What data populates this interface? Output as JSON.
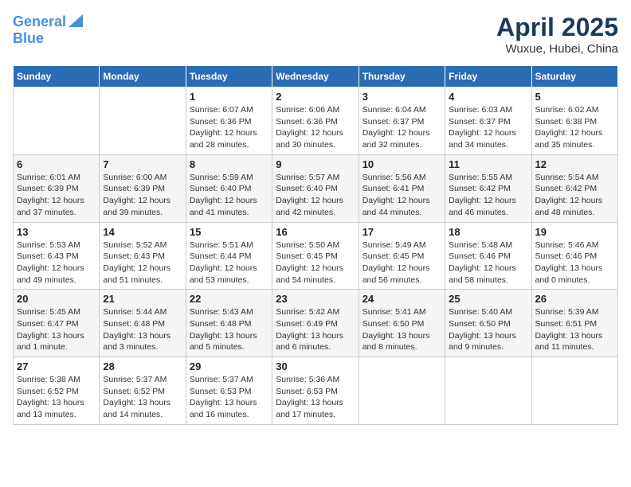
{
  "header": {
    "logo_line1": "General",
    "logo_line2": "Blue",
    "month_title": "April 2025",
    "location": "Wuxue, Hubei, China"
  },
  "weekdays": [
    "Sunday",
    "Monday",
    "Tuesday",
    "Wednesday",
    "Thursday",
    "Friday",
    "Saturday"
  ],
  "weeks": [
    [
      {
        "day": "",
        "info": ""
      },
      {
        "day": "",
        "info": ""
      },
      {
        "day": "1",
        "info": "Sunrise: 6:07 AM\nSunset: 6:36 PM\nDaylight: 12 hours and 28 minutes."
      },
      {
        "day": "2",
        "info": "Sunrise: 6:06 AM\nSunset: 6:36 PM\nDaylight: 12 hours and 30 minutes."
      },
      {
        "day": "3",
        "info": "Sunrise: 6:04 AM\nSunset: 6:37 PM\nDaylight: 12 hours and 32 minutes."
      },
      {
        "day": "4",
        "info": "Sunrise: 6:03 AM\nSunset: 6:37 PM\nDaylight: 12 hours and 34 minutes."
      },
      {
        "day": "5",
        "info": "Sunrise: 6:02 AM\nSunset: 6:38 PM\nDaylight: 12 hours and 35 minutes."
      }
    ],
    [
      {
        "day": "6",
        "info": "Sunrise: 6:01 AM\nSunset: 6:39 PM\nDaylight: 12 hours and 37 minutes."
      },
      {
        "day": "7",
        "info": "Sunrise: 6:00 AM\nSunset: 6:39 PM\nDaylight: 12 hours and 39 minutes."
      },
      {
        "day": "8",
        "info": "Sunrise: 5:59 AM\nSunset: 6:40 PM\nDaylight: 12 hours and 41 minutes."
      },
      {
        "day": "9",
        "info": "Sunrise: 5:57 AM\nSunset: 6:40 PM\nDaylight: 12 hours and 42 minutes."
      },
      {
        "day": "10",
        "info": "Sunrise: 5:56 AM\nSunset: 6:41 PM\nDaylight: 12 hours and 44 minutes."
      },
      {
        "day": "11",
        "info": "Sunrise: 5:55 AM\nSunset: 6:42 PM\nDaylight: 12 hours and 46 minutes."
      },
      {
        "day": "12",
        "info": "Sunrise: 5:54 AM\nSunset: 6:42 PM\nDaylight: 12 hours and 48 minutes."
      }
    ],
    [
      {
        "day": "13",
        "info": "Sunrise: 5:53 AM\nSunset: 6:43 PM\nDaylight: 12 hours and 49 minutes."
      },
      {
        "day": "14",
        "info": "Sunrise: 5:52 AM\nSunset: 6:43 PM\nDaylight: 12 hours and 51 minutes."
      },
      {
        "day": "15",
        "info": "Sunrise: 5:51 AM\nSunset: 6:44 PM\nDaylight: 12 hours and 53 minutes."
      },
      {
        "day": "16",
        "info": "Sunrise: 5:50 AM\nSunset: 6:45 PM\nDaylight: 12 hours and 54 minutes."
      },
      {
        "day": "17",
        "info": "Sunrise: 5:49 AM\nSunset: 6:45 PM\nDaylight: 12 hours and 56 minutes."
      },
      {
        "day": "18",
        "info": "Sunrise: 5:48 AM\nSunset: 6:46 PM\nDaylight: 12 hours and 58 minutes."
      },
      {
        "day": "19",
        "info": "Sunrise: 5:46 AM\nSunset: 6:46 PM\nDaylight: 13 hours and 0 minutes."
      }
    ],
    [
      {
        "day": "20",
        "info": "Sunrise: 5:45 AM\nSunset: 6:47 PM\nDaylight: 13 hours and 1 minute."
      },
      {
        "day": "21",
        "info": "Sunrise: 5:44 AM\nSunset: 6:48 PM\nDaylight: 13 hours and 3 minutes."
      },
      {
        "day": "22",
        "info": "Sunrise: 5:43 AM\nSunset: 6:48 PM\nDaylight: 13 hours and 5 minutes."
      },
      {
        "day": "23",
        "info": "Sunrise: 5:42 AM\nSunset: 6:49 PM\nDaylight: 13 hours and 6 minutes."
      },
      {
        "day": "24",
        "info": "Sunrise: 5:41 AM\nSunset: 6:50 PM\nDaylight: 13 hours and 8 minutes."
      },
      {
        "day": "25",
        "info": "Sunrise: 5:40 AM\nSunset: 6:50 PM\nDaylight: 13 hours and 9 minutes."
      },
      {
        "day": "26",
        "info": "Sunrise: 5:39 AM\nSunset: 6:51 PM\nDaylight: 13 hours and 11 minutes."
      }
    ],
    [
      {
        "day": "27",
        "info": "Sunrise: 5:38 AM\nSunset: 6:52 PM\nDaylight: 13 hours and 13 minutes."
      },
      {
        "day": "28",
        "info": "Sunrise: 5:37 AM\nSunset: 6:52 PM\nDaylight: 13 hours and 14 minutes."
      },
      {
        "day": "29",
        "info": "Sunrise: 5:37 AM\nSunset: 6:53 PM\nDaylight: 13 hours and 16 minutes."
      },
      {
        "day": "30",
        "info": "Sunrise: 5:36 AM\nSunset: 6:53 PM\nDaylight: 13 hours and 17 minutes."
      },
      {
        "day": "",
        "info": ""
      },
      {
        "day": "",
        "info": ""
      },
      {
        "day": "",
        "info": ""
      }
    ]
  ]
}
